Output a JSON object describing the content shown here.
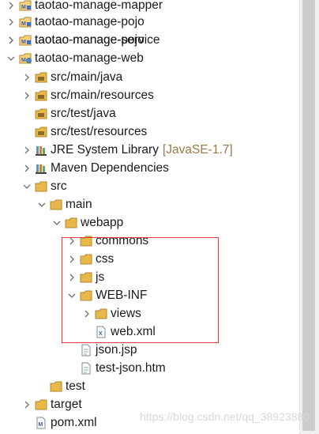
{
  "tree": {
    "items": [
      {
        "label": "taotao-manage-mapper",
        "icon": "maven-project-icon",
        "arrow": "collapsed"
      },
      {
        "label": "taotao-manage-pojo",
        "icon": "maven-project-icon",
        "arrow": "collapsed"
      },
      {
        "label": "taotao-manage-service",
        "icon": "maven-project-icon",
        "arrow": "collapsed"
      },
      {
        "label": "taotao-manage-web",
        "icon": "maven-web-project-icon",
        "arrow": "expanded"
      },
      {
        "label": "src/main/java",
        "icon": "source-folder-icon",
        "arrow": "collapsed"
      },
      {
        "label": "src/main/resources",
        "icon": "source-folder-icon",
        "arrow": "collapsed"
      },
      {
        "label": "src/test/java",
        "icon": "source-folder-icon",
        "arrow": "none"
      },
      {
        "label": "src/test/resources",
        "icon": "source-folder-icon",
        "arrow": "none"
      },
      {
        "label": "JRE System Library",
        "suffix": "[JavaSE-1.7]",
        "icon": "library-icon",
        "arrow": "collapsed"
      },
      {
        "label": "Maven Dependencies",
        "icon": "library-icon",
        "arrow": "collapsed"
      },
      {
        "label": "src",
        "icon": "folder-icon",
        "arrow": "expanded"
      },
      {
        "label": "main",
        "icon": "folder-icon",
        "arrow": "expanded"
      },
      {
        "label": "webapp",
        "icon": "folder-icon",
        "arrow": "expanded"
      },
      {
        "label": "commons",
        "icon": "folder-icon",
        "arrow": "collapsed"
      },
      {
        "label": "css",
        "icon": "folder-icon",
        "arrow": "collapsed"
      },
      {
        "label": "js",
        "icon": "folder-icon",
        "arrow": "collapsed"
      },
      {
        "label": "WEB-INF",
        "icon": "folder-icon",
        "arrow": "expanded"
      },
      {
        "label": "views",
        "icon": "folder-icon",
        "arrow": "collapsed"
      },
      {
        "label": "web.xml",
        "icon": "xml-file-icon",
        "arrow": "none"
      },
      {
        "label": "json.jsp",
        "icon": "file-icon",
        "arrow": "none"
      },
      {
        "label": "test-json.htm",
        "icon": "file-icon",
        "arrow": "none"
      },
      {
        "label": "test",
        "icon": "folder-icon",
        "arrow": "none"
      },
      {
        "label": "target",
        "icon": "folder-icon",
        "arrow": "collapsed"
      },
      {
        "label": "pom.xml",
        "icon": "maven-pom-icon",
        "arrow": "none"
      }
    ]
  },
  "watermark": "https://blog.csdn.net/qq_38923880",
  "colors": {
    "highlight_box": "#e23b3b",
    "folder": "#e9b84a",
    "suffix_text": "#9a7a4a"
  }
}
